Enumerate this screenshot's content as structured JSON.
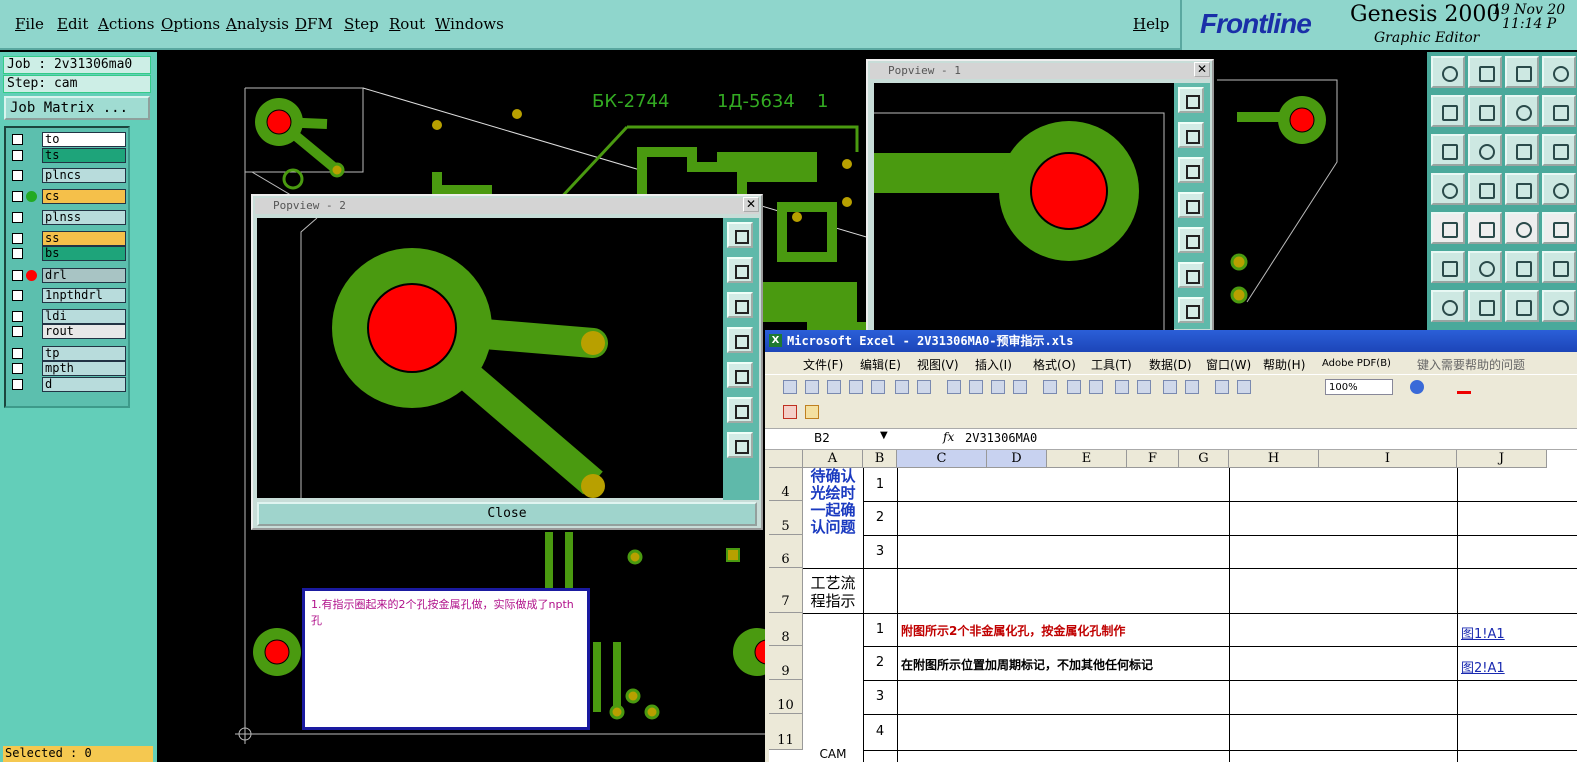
{
  "menubar": {
    "items": [
      "File",
      "Edit",
      "Actions",
      "Options",
      "Analysis",
      "DFM",
      "Step",
      "Rout",
      "Windows"
    ],
    "help": "Help"
  },
  "brand": {
    "logo": "Frontline",
    "product": "Genesis 2000",
    "subtitle": "Graphic Editor",
    "date": "19 Nov 20",
    "time": "11:14 P"
  },
  "left_panel": {
    "job": "Job : 2v31306ma0",
    "step": "Step: cam",
    "job_matrix": "Job Matrix ...",
    "layers": [
      {
        "name": "to",
        "color": "#ffffff",
        "dot": ""
      },
      {
        "name": "ts",
        "color": "#1ea47a",
        "dot": ""
      },
      {
        "name": "plncs",
        "color": "#b8dcdc",
        "dot": ""
      },
      {
        "name": "cs",
        "color": "#f5c04a",
        "dot": "#22aa22"
      },
      {
        "name": "plnss",
        "color": "#b8dcdc",
        "dot": ""
      },
      {
        "name": "ss",
        "color": "#f5c04a",
        "dot": ""
      },
      {
        "name": "bs",
        "color": "#1ea47a",
        "dot": ""
      },
      {
        "name": "drl",
        "color": "#a8c4c4",
        "dot": "#ff0000"
      },
      {
        "name": "1npthdrl",
        "color": "#b8dcdc",
        "dot": ""
      },
      {
        "name": "ldi",
        "color": "#b8dcdc",
        "dot": ""
      },
      {
        "name": "rout",
        "color": "#e8e8e8",
        "dot": ""
      },
      {
        "name": "tp",
        "color": "#b8dcdc",
        "dot": ""
      },
      {
        "name": "mpth",
        "color": "#b8dcdc",
        "dot": ""
      },
      {
        "name": "d",
        "color": "#b8dcdc",
        "dot": ""
      }
    ],
    "selected": "Selected : 0"
  },
  "canvas": {
    "board_text_1": "БК-2744",
    "board_text_2": "1Д-5634",
    "board_text_3": "1"
  },
  "popview2": {
    "title": "Popview - 2",
    "close_label": "Close"
  },
  "popview1": {
    "title": "Popview - 1"
  },
  "note": {
    "text": "1.有指示圈起来的2个孔按金属孔做，实际做成了npth孔"
  },
  "excel": {
    "title": "Microsoft Excel - 2V31306MA0-预审指示.xls",
    "menu": [
      "文件(F)",
      "编辑(E)",
      "视图(V)",
      "插入(I)",
      "格式(O)",
      "工具(T)",
      "数据(D)",
      "窗口(W)",
      "帮助(H)",
      "Adobe PDF(B)"
    ],
    "help_placeholder": "键入需要帮助的问题",
    "zoom": "100%",
    "name_box": "B2",
    "fx_label": "fx",
    "formula": "2V31306MA0",
    "columns": [
      "A",
      "B",
      "C",
      "D",
      "E",
      "F",
      "G",
      "H",
      "I",
      "J"
    ],
    "rows": [
      "4",
      "5",
      "6",
      "7",
      "8",
      "9",
      "10",
      "11"
    ],
    "a_confirm": "待确认光绘时一起确认问题",
    "a_process": "工艺流程指示",
    "a_cam": "CAM",
    "b_values": [
      "1",
      "2",
      "3",
      "1",
      "2",
      "3",
      "4"
    ],
    "instr_1": "附图所示2个非金属化孔，按金属化孔制作",
    "instr_2": "在附图所示位置加周期标记，不加其他任何标记",
    "link_1": "图1!A1",
    "link_2": "图2!A1"
  }
}
